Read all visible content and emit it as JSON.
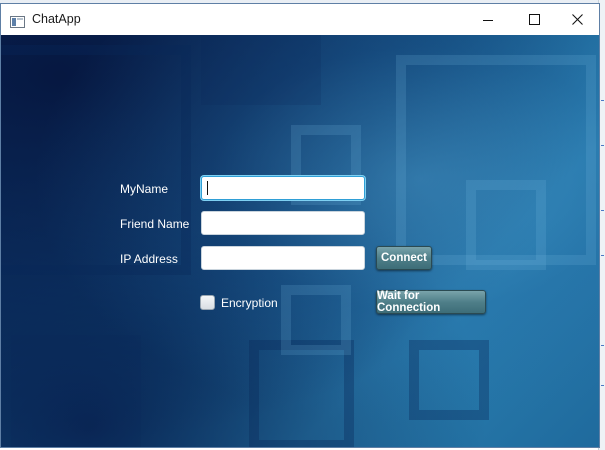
{
  "window": {
    "title": "ChatApp"
  },
  "form": {
    "my_name_label": "MyName",
    "my_name_value": "",
    "friend_name_label": "Friend Name",
    "friend_name_value": "",
    "ip_address_label": "IP Address",
    "ip_address_value": "",
    "connect_label": "Connect",
    "encryption_label": "Encryption",
    "encryption_checked": false,
    "wait_label": "Wait for Connection"
  },
  "colors": {
    "button_bg": "#4f7f89",
    "focus_border": "#2f9fd6",
    "background_main": "#175a8c"
  }
}
